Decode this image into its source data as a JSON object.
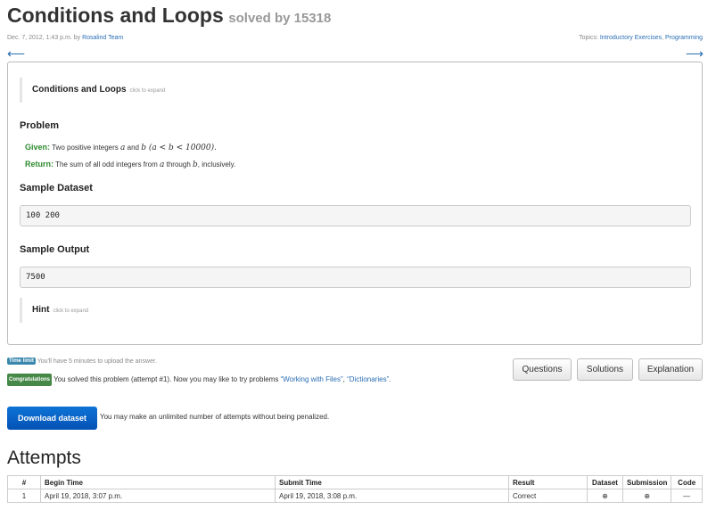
{
  "header": {
    "title": "Conditions and Loops",
    "solved_label": "solved by 15318",
    "date_prefix": "Dec. 7, 2012, 1:43 p.m. by ",
    "author": "Rosalind Team",
    "topics_prefix": "Topics: ",
    "topic_1": "Introductory Exercises",
    "topic_sep": ", ",
    "topic_2": "Programming",
    "prev_arrow": "⟵",
    "next_arrow": "⟶"
  },
  "problem": {
    "intro_title": "Conditions and Loops",
    "intro_expand": "click to expand",
    "problem_heading": "Problem",
    "given_label": "Given:",
    "given_text": " Two positive integers ",
    "given_a": "a",
    "given_and": " and ",
    "given_b": "b",
    "given_cond": " (a < b < 10000).",
    "return_label": "Return:",
    "return_text_1": " The sum of all odd integers from ",
    "return_a": "a",
    "return_text_2": " through ",
    "return_b": "b",
    "return_text_3": ", inclusively.",
    "sample_dataset_heading": "Sample Dataset",
    "sample_dataset": "100 200",
    "sample_output_heading": "Sample Output",
    "sample_output": "7500",
    "hint_title": "Hint",
    "hint_expand": "click to expand"
  },
  "status": {
    "time_limit_badge": "Time limit",
    "time_limit_text": " You'll have 5 minutes to upload the answer.",
    "congrats_badge": "Congratulations",
    "congrats_text": " You solved this problem (attempt #1). Now you may like to try problems ",
    "link_1": "“Working with Files”",
    "link_sep": ", ",
    "link_2": "“Dictionaries”",
    "end": "."
  },
  "buttons": {
    "questions": "Questions",
    "solutions": "Solutions",
    "explanation": "Explanation",
    "download": "Download dataset",
    "download_note": "You may make an unlimited number of attempts without being penalized."
  },
  "attempts": {
    "title": "Attempts",
    "columns": [
      "#",
      "Begin Time",
      "Submit Time",
      "Result",
      "Dataset",
      "Submission",
      "Code"
    ],
    "rows": [
      {
        "num": "1",
        "begin": "April 19, 2018, 3:07 p.m.",
        "submit": "April 19, 2018, 3:08 p.m.",
        "result": "Correct",
        "dataset": "⊕",
        "submission": "⊕",
        "code": "—"
      }
    ]
  },
  "colors": {
    "link": "#2a6eb4",
    "given_label": "#2e8b2e",
    "badge_time": "#3a87ad",
    "badge_congrats": "#468847",
    "download_button": "#0452b4"
  }
}
